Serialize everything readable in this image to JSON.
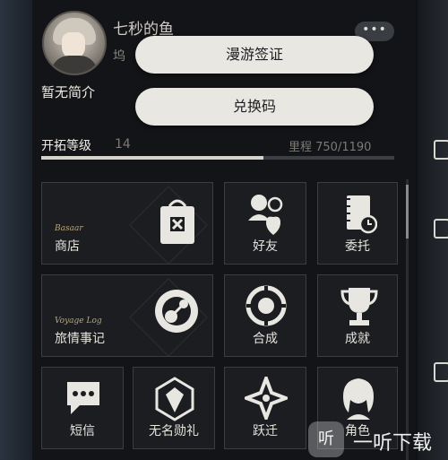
{
  "profile": {
    "username": "七秒的鱼",
    "uid_fragment": "坞",
    "bio": "暂无简介",
    "more": "•••"
  },
  "popup_menu": {
    "items": [
      "漫游签证",
      "兑换码"
    ]
  },
  "trailblaze": {
    "label": "开拓等级",
    "level": "14",
    "mileage_text": "里程 750/1190",
    "progress": 0.63
  },
  "tiles": {
    "shop": {
      "label": "商店",
      "sub": "Basaar"
    },
    "friends": {
      "label": "好友"
    },
    "assignments": {
      "label": "委托"
    },
    "travel_log": {
      "label": "旅情事记",
      "sub": "Voyage Log"
    },
    "synthesis": {
      "label": "合成"
    },
    "achievements": {
      "label": "成就"
    },
    "messages": {
      "label": "短信"
    },
    "nameless_honor": {
      "label": "无名勋礼"
    },
    "warp": {
      "label": "跃迁"
    },
    "characters": {
      "label": "角色"
    }
  },
  "watermark": {
    "mark": "听",
    "text": "一听下载"
  },
  "colors": {
    "panel": "#121417",
    "tile": "#1b1d21",
    "button": "#e9e7e2"
  }
}
